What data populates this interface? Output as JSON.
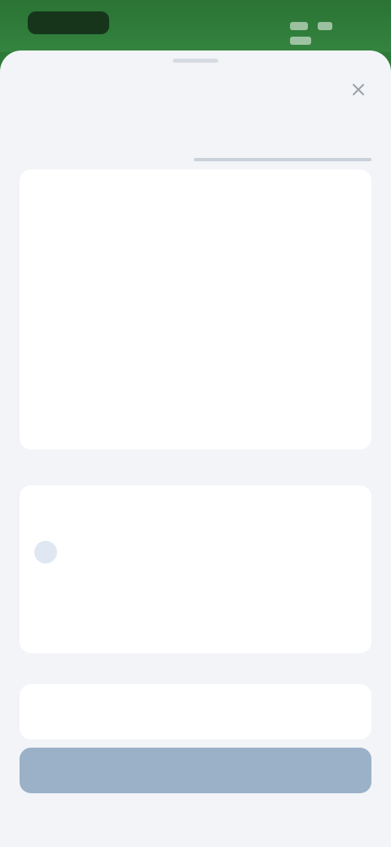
{
  "status_bar": {
    "time": "",
    "indicators": [
      "signal-icon",
      "wifi-icon",
      "battery-icon"
    ]
  },
  "sheet": {
    "title": "",
    "close_icon": "close-icon"
  },
  "tabs": [
    {
      "label": "",
      "active": false
    },
    {
      "label": "",
      "active": true
    }
  ],
  "details": {
    "rows": [
      {
        "label": "",
        "value": ""
      },
      {
        "label": "",
        "value": ""
      },
      {
        "label": "",
        "value": ""
      }
    ],
    "description_label": "",
    "description_text": ""
  },
  "assignees": {
    "title": "",
    "item_name": "",
    "item_meta": "",
    "add_label": ""
  },
  "category": {
    "label": "",
    "value": ""
  },
  "primary_button": {
    "label": ""
  },
  "colors": {
    "status_bar_green": "#2d7a38",
    "accent_link": "#6fa8d8",
    "button_disabled": "#9bb1c8",
    "sheet_bg": "#f2f4f7"
  }
}
